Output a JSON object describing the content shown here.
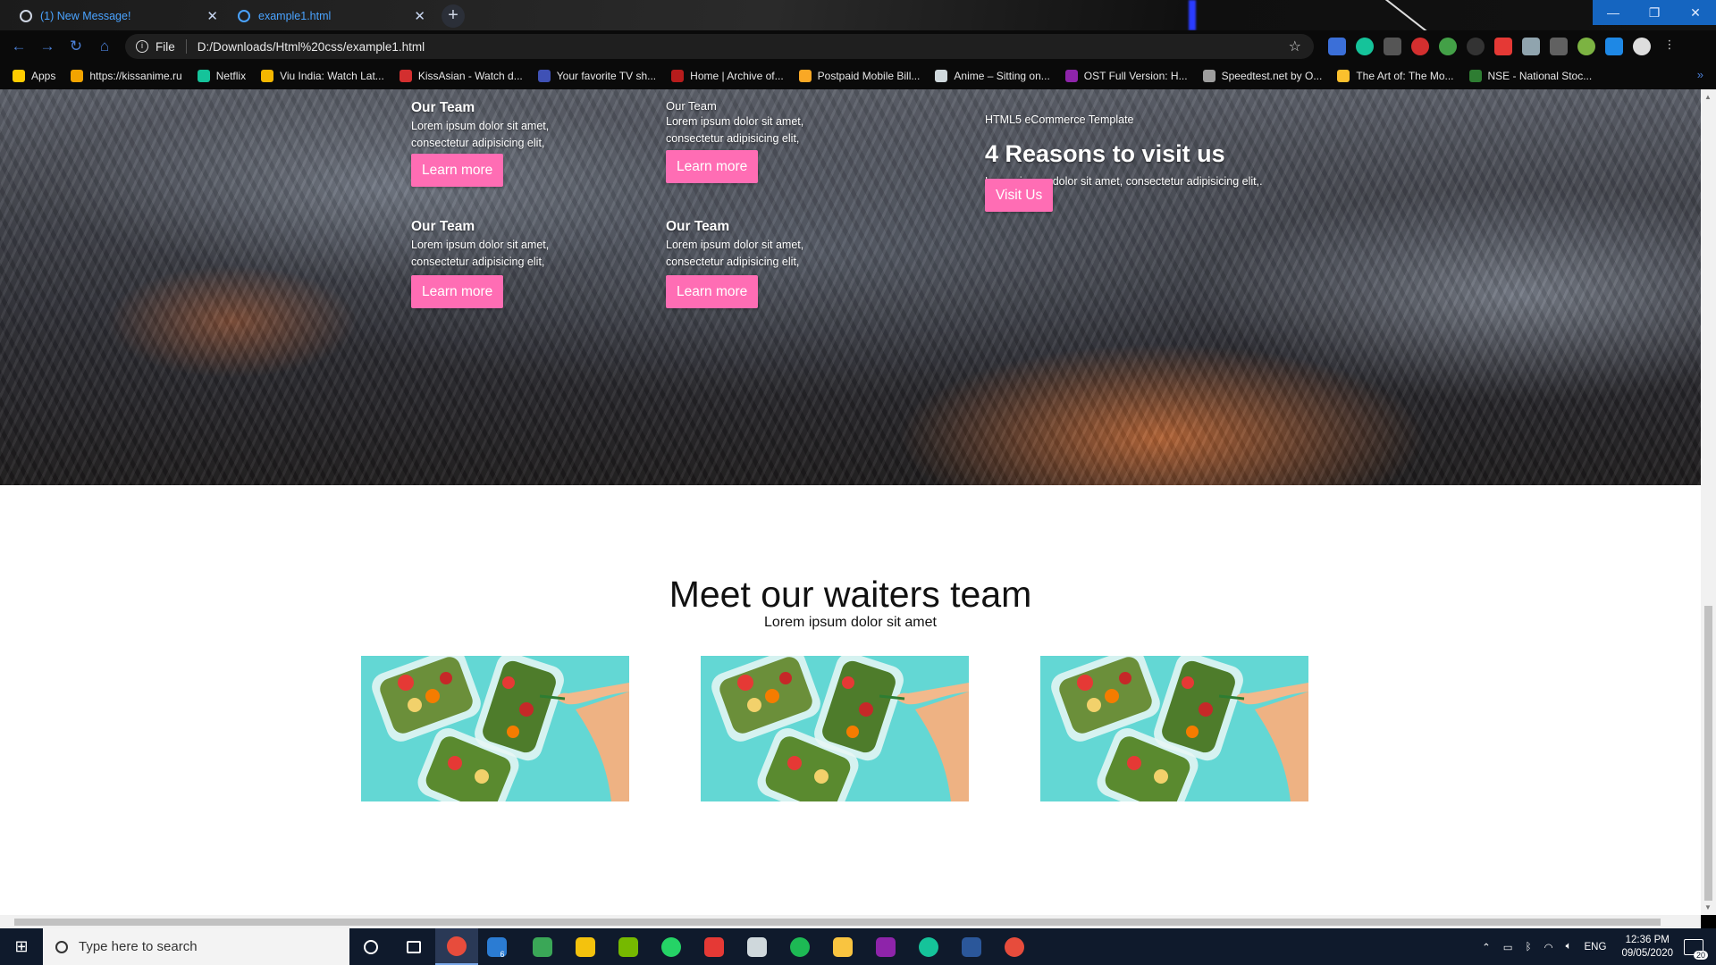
{
  "browser": {
    "tabs": [
      {
        "label": "(1) New Message!",
        "close": "✕",
        "icon": "chat-icon"
      },
      {
        "label": "example1.html",
        "close": "✕",
        "icon": "globe-icon"
      }
    ],
    "new_tab": "+",
    "window_controls": {
      "minimize": "—",
      "restore": "❐",
      "close": "✕"
    },
    "address": {
      "scheme_label": "File",
      "url": "D:/Downloads/Html%20css/example1.html",
      "info": "i",
      "star": "☆"
    },
    "nav": {
      "back": "←",
      "forward": "→",
      "reload": "↻",
      "home": "⌂"
    },
    "bookmarks": [
      {
        "label": "Apps",
        "color": "#ffcc00"
      },
      {
        "label": "https://kissanime.ru",
        "color": "#f2a400"
      },
      {
        "label": "Netflix",
        "color": "#15c39a"
      },
      {
        "label": "Viu India: Watch Lat...",
        "color": "#f5b700"
      },
      {
        "label": "KissAsian - Watch d...",
        "color": "#d32f2f"
      },
      {
        "label": "Your favorite TV sh...",
        "color": "#3f51b5"
      },
      {
        "label": "Home | Archive of...",
        "color": "#b71c1c"
      },
      {
        "label": "Postpaid Mobile Bill...",
        "color": "#f9a825"
      },
      {
        "label": "Anime – Sitting on...",
        "color": "#cfd8dc"
      },
      {
        "label": "OST Full Version: H...",
        "color": "#8e24aa"
      },
      {
        "label": "Speedtest.net by O...",
        "color": "#9e9e9e"
      },
      {
        "label": "The Art of: The Mo...",
        "color": "#fbc02d"
      },
      {
        "label": "NSE - National Stoc...",
        "color": "#2e7d32"
      }
    ],
    "bookmarks_more": "»"
  },
  "hero": {
    "features": [
      {
        "title": "Our Team",
        "text_line1": "Lorem ipsum dolor sit amet,",
        "text_line2": "consectetur adipisicing elit,",
        "button": "Learn more"
      },
      {
        "title": "Our Team",
        "text_line1": "Lorem ipsum dolor sit amet,",
        "text_line2": "consectetur adipisicing elit,",
        "button": "Learn more"
      },
      {
        "title": "Our Team",
        "text_line1": "Lorem ipsum dolor sit amet,",
        "text_line2": "consectetur adipisicing elit,",
        "button": "Learn more"
      },
      {
        "title": "Our Team",
        "text_line1": "Lorem ipsum dolor sit amet,",
        "text_line2": "consectetur adipisicing elit,",
        "button": "Learn more"
      }
    ],
    "reasons": {
      "kicker": "HTML5 eCommerce Template",
      "title": "4 Reasons to visit us",
      "text": "Lorem ipsum dolor sit amet, consectetur adipisicing elit,.",
      "button": "Visit Us"
    }
  },
  "team": {
    "title": "Meet our waiters team",
    "subtitle": "Lorem ipsum dolor sit amet"
  },
  "taskbar": {
    "search_placeholder": "Type here to search",
    "apps": [
      {
        "name": "cortana-icon",
        "color": "#ffffff"
      },
      {
        "name": "task-view-icon",
        "color": "#ffffff"
      },
      {
        "name": "chrome-icon",
        "color": "#e74c3c"
      },
      {
        "name": "mail-icon",
        "color": "#2b7cd3"
      },
      {
        "name": "edge-icon",
        "color": "#3aa757"
      },
      {
        "name": "player-icon",
        "color": "#f4c20d"
      },
      {
        "name": "nvidia-icon",
        "color": "#76b900"
      },
      {
        "name": "whatsapp-icon",
        "color": "#25d366"
      },
      {
        "name": "app-icon",
        "color": "#e53935"
      },
      {
        "name": "news-icon",
        "color": "#cfd8dc"
      },
      {
        "name": "spotify-icon",
        "color": "#1db954"
      },
      {
        "name": "file-explorer-icon",
        "color": "#f9c440"
      },
      {
        "name": "podcast-icon",
        "color": "#8e24aa"
      },
      {
        "name": "grammarly-icon",
        "color": "#15c39a"
      },
      {
        "name": "word-icon",
        "color": "#2b579a"
      },
      {
        "name": "chrome-profile-icon",
        "color": "#e74c3c"
      }
    ],
    "mail_badge": "6",
    "tray": {
      "language": "ENG",
      "time": "12:36 PM",
      "date": "09/05/2020",
      "notifications": "20"
    }
  },
  "colors": {
    "accent_pink": "#ff6db4",
    "tab_text": "#4aa3ff",
    "taskbar": "#0f1a2c"
  }
}
